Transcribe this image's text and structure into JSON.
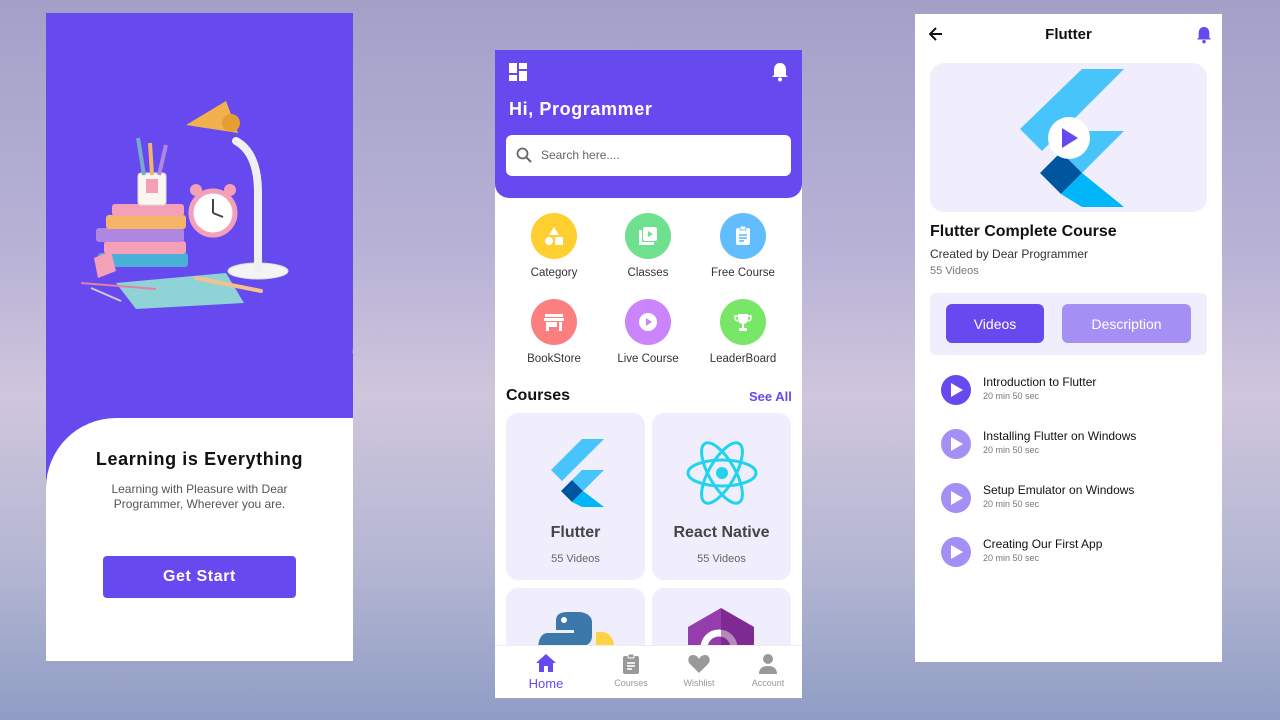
{
  "colors": {
    "primary": "#674aef",
    "light_primary": "#a490f5",
    "card_bg": "#f0eefc"
  },
  "splash": {
    "title": "Learning is Everything",
    "subtitle": "Learning with Pleasure with Dear Programmer, Wherever you are.",
    "button": "Get Start"
  },
  "home": {
    "greeting": "Hi, Programmer",
    "search": {
      "placeholder": "Search here...."
    },
    "categories": [
      {
        "label": "Category",
        "icon": "category-icon",
        "color": "#ffcf2f"
      },
      {
        "label": "Classes",
        "icon": "video-library-icon",
        "color": "#6fe08d"
      },
      {
        "label": "Free Course",
        "icon": "assignment-icon",
        "color": "#61bdfd"
      },
      {
        "label": "BookStore",
        "icon": "store-icon",
        "color": "#fc7f7f"
      },
      {
        "label": "Live Course",
        "icon": "play-circle-icon",
        "color": "#cb84fb"
      },
      {
        "label": "LeaderBoard",
        "icon": "trophy-icon",
        "color": "#78e667"
      }
    ],
    "courses_title": "Courses",
    "see_all": "See All",
    "courses": [
      {
        "name": "Flutter",
        "videos": "55 Videos",
        "icon": "flutter-logo"
      },
      {
        "name": "React Native",
        "videos": "55 Videos",
        "icon": "react-logo"
      },
      {
        "name": "",
        "videos": "",
        "icon": "python-logo"
      },
      {
        "name": "",
        "videos": "",
        "icon": "csharp-logo"
      }
    ],
    "nav": [
      {
        "label": "Home",
        "icon": "home-icon",
        "active": true
      },
      {
        "label": "Courses",
        "icon": "assignment-icon",
        "active": false
      },
      {
        "label": "Wishlist",
        "icon": "heart-icon",
        "active": false
      },
      {
        "label": "Account",
        "icon": "person-icon",
        "active": false
      }
    ]
  },
  "detail": {
    "title": "Flutter",
    "course_title": "Flutter Complete Course",
    "created_by": "Created by Dear Programmer",
    "videos": "55 Videos",
    "tabs": [
      "Videos",
      "Description"
    ],
    "video_list": [
      {
        "title": "Introduction to Flutter",
        "duration": "20 min 50 sec",
        "active": true
      },
      {
        "title": "Installing Flutter on Windows",
        "duration": "20 min 50 sec",
        "active": false
      },
      {
        "title": "Setup Emulator on Windows",
        "duration": "20 min 50 sec",
        "active": false
      },
      {
        "title": "Creating Our First App",
        "duration": "20 min 50 sec",
        "active": false
      }
    ]
  }
}
